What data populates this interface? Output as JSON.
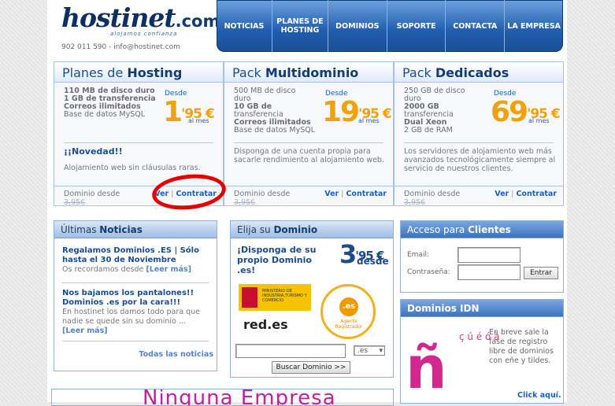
{
  "header": {
    "logo_main": "hostinet",
    "logo_com": ".com",
    "logo_tagline": "alojamos confianza",
    "contact": "902 011 590 - info@hostinet.com"
  },
  "nav": [
    "NOTICIAS",
    "PLANES DE HOSTING",
    "DOMINIOS",
    "SOPORTE",
    "CONTACTA",
    "LA EMPRESA"
  ],
  "packs": [
    {
      "title_prefix": "Planes de ",
      "title_bold": "Hosting",
      "specs": [
        "110 MB de disco duro",
        "1 GB de transferencia",
        "Correos ilimitados",
        "Base de datos MySQL"
      ],
      "desde": "Desde",
      "price_int": "1",
      "price_dec": "'95 €",
      "per_month": "al mes",
      "novedad": "¡¡Novedad!!",
      "note": "Alojamiento web sin cláusulas raras.",
      "foot_label": "Dominio desde",
      "foot_price": "3,95€",
      "link_ver": "Ver",
      "link_sep": " | ",
      "link_contratar": "Contratar"
    },
    {
      "title_prefix": "Pack ",
      "title_bold": "Multidominio",
      "specs": [
        "500 MB de disco",
        "duro",
        "10 GB de",
        "transferencia",
        "Correos ilimitados",
        "Base de datos MySQL"
      ],
      "desde": "Desde",
      "price_int": "19",
      "price_dec": "'95 €",
      "per_month": "al mes",
      "note": "Disponga de una cuenta propia para sacarle rendimiento al alojamiento web.",
      "foot_label": "Dominio desde",
      "foot_price": "3,95€",
      "link_ver": "Ver",
      "link_sep": " | ",
      "link_contratar": "Contratar"
    },
    {
      "title_prefix": "Pack ",
      "title_bold": "Dedicados",
      "specs": [
        "250 GB de disco",
        "duro",
        "2000 GB",
        "transferencia",
        "Dual Xeon",
        "2 GB de RAM"
      ],
      "desde": "Desde",
      "price_int": "69",
      "price_dec": "'95 €",
      "per_month": "al mes",
      "note": "Los servidores de alojamiento web más avanzados tecnológicamente siempre al servicio de nuestros clientes.",
      "foot_label": "Dominio desde",
      "foot_price": "3,95€",
      "link_ver": "Ver",
      "link_sep": " | ",
      "link_contratar": "Contratar"
    }
  ],
  "news": {
    "title_prefix": "Últimas ",
    "title_bold": "Noticias",
    "items": [
      {
        "title": "Regalamos Dominios .ES | Sólo hasta el 30 de Noviembre",
        "text": "Os recordamos desde",
        "more": "[Leer más]"
      },
      {
        "title": "Nos bajamos los pantalones!! Dominios .es por la cara!!!",
        "text": "En hostinet los damos todo para que nadie se quede sin su dominio ...",
        "more": "[Leer más]"
      }
    ],
    "all_link": "Todas las noticias"
  },
  "domain": {
    "title_prefix": "Elija su ",
    "title_bold": "Dominio",
    "promo": "¡Disponga de su propio Dominio .es!",
    "price_int": "3",
    "price_dec": "'95 €",
    "price_desde": "desde",
    "ministerio": "MINISTERIO DE INDUSTRIA,TURISMO Y COMERCIO",
    "redes": "red.es",
    "seal_es": ".es",
    "seal_agent": "Agente Registrador",
    "search_value": "",
    "tld_selected": ".es",
    "search_button": "Buscar Dominio >>"
  },
  "clients": {
    "title_prefix": "Acceso para ",
    "title_bold": "Clientes",
    "email_label": "Email:",
    "password_label": "Contraseña:",
    "email_value": "",
    "password_value": "",
    "submit": "Entrar"
  },
  "idn": {
    "title": "Dominios IDN",
    "text": "En breve sale la fase de registro libre de dominios con eñe y tildes.",
    "link": "Click aquí."
  },
  "banner_text": "Ninguna Empresa"
}
